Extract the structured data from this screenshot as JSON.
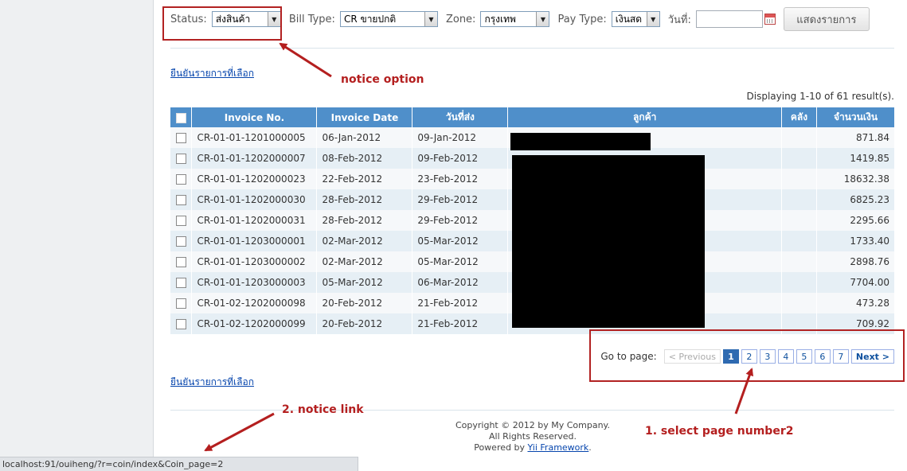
{
  "filters": {
    "status": {
      "label": "Status:",
      "value": "ส่งสินค้า"
    },
    "bill_type": {
      "label": "Bill Type:",
      "value": "CR ขายปกติ"
    },
    "zone": {
      "label": "Zone:",
      "value": "กรุงเทพ"
    },
    "pay_type": {
      "label": "Pay Type:",
      "value": "เงินสด"
    },
    "date": {
      "label": "วันที่:",
      "value": ""
    },
    "show_button": "แสดงรายการ"
  },
  "confirm_link": "ยืนยันรายการที่เลือก",
  "summary": "Displaying 1-10 of 61 result(s).",
  "table": {
    "headers": [
      "Invoice No.",
      "Invoice Date",
      "วันที่ส่ง",
      "ลูกค้า",
      "คลัง",
      "จำนวนเงิน"
    ],
    "rows": [
      {
        "invoice": "CR-01-01-1201000005",
        "invoice_date": "06-Jan-2012",
        "ship_date": "09-Jan-2012",
        "amount": "871.84"
      },
      {
        "invoice": "CR-01-01-1202000007",
        "invoice_date": "08-Feb-2012",
        "ship_date": "09-Feb-2012",
        "amount": "1419.85"
      },
      {
        "invoice": "CR-01-01-1202000023",
        "invoice_date": "22-Feb-2012",
        "ship_date": "23-Feb-2012",
        "amount": "18632.38"
      },
      {
        "invoice": "CR-01-01-1202000030",
        "invoice_date": "28-Feb-2012",
        "ship_date": "29-Feb-2012",
        "amount": "6825.23"
      },
      {
        "invoice": "CR-01-01-1202000031",
        "invoice_date": "28-Feb-2012",
        "ship_date": "29-Feb-2012",
        "amount": "2295.66"
      },
      {
        "invoice": "CR-01-01-1203000001",
        "invoice_date": "02-Mar-2012",
        "ship_date": "05-Mar-2012",
        "amount": "1733.40"
      },
      {
        "invoice": "CR-01-01-1203000002",
        "invoice_date": "02-Mar-2012",
        "ship_date": "05-Mar-2012",
        "amount": "2898.76"
      },
      {
        "invoice": "CR-01-01-1203000003",
        "invoice_date": "05-Mar-2012",
        "ship_date": "06-Mar-2012",
        "amount": "7704.00"
      },
      {
        "invoice": "CR-01-02-1202000098",
        "invoice_date": "20-Feb-2012",
        "ship_date": "21-Feb-2012",
        "amount": "473.28"
      },
      {
        "invoice": "CR-01-02-1202000099",
        "invoice_date": "20-Feb-2012",
        "ship_date": "21-Feb-2012",
        "amount": "709.92"
      }
    ]
  },
  "pager": {
    "label": "Go to page:",
    "prev": "< Previous",
    "pages": [
      "1",
      "2",
      "3",
      "4",
      "5",
      "6",
      "7"
    ],
    "selected": "1",
    "next": "Next >"
  },
  "footer": {
    "line1": "Copyright © 2012 by My Company.",
    "line2": "All Rights Reserved.",
    "powered_prefix": "Powered by",
    "powered_link": "Yii Framework",
    "powered_suffix": "."
  },
  "status_bar_url": "localhost:91/ouiheng/?r=coin/index&Coin_page=2",
  "annotations": {
    "notice_option": "notice option",
    "notice_link": "2. notice link",
    "select_page": "1. select page number2",
    "color": "#b41f1f"
  }
}
